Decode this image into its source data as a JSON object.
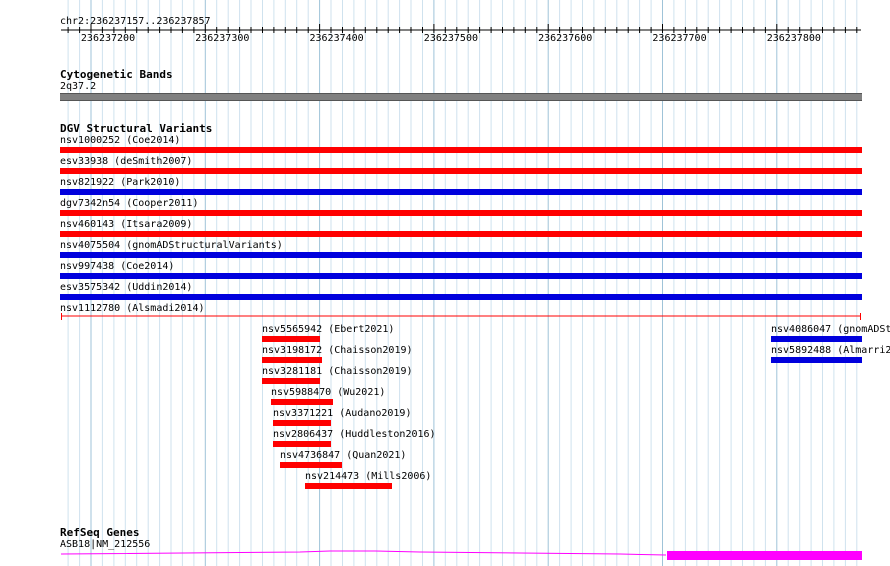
{
  "location": "chr2:236237157..236237857",
  "ruler": {
    "ticks": [
      "236237200",
      "236237300",
      "236237400",
      "236237500",
      "236237600",
      "236237700",
      "236237800"
    ]
  },
  "colors": {
    "gain_loss_red": "#ff0000",
    "gain_blue": "#0000dd",
    "band": "#808080",
    "refseq": "#ff00ff",
    "grid": "#b4d4e4"
  },
  "tracks": {
    "cytoband": {
      "title": "Cytogenetic Bands",
      "band_label": "2q37.2"
    },
    "dgv": {
      "title": "DGV Structural Variants",
      "full_width_features": [
        {
          "label": "nsv1000252 (Coe2014)",
          "color": "red"
        },
        {
          "label": "esv33938 (deSmith2007)",
          "color": "red"
        },
        {
          "label": "nsv821922 (Park2010)",
          "color": "blue"
        },
        {
          "label": "dgv7342n54 (Cooper2011)",
          "color": "red"
        },
        {
          "label": "nsv460143 (Itsara2009)",
          "color": "red"
        },
        {
          "label": "nsv4075504 (gnomADStructuralVariants)",
          "color": "blue"
        },
        {
          "label": "nsv997438 (Coe2014)",
          "color": "blue"
        },
        {
          "label": "esv3575342 (Uddin2014)",
          "color": "blue"
        },
        {
          "label": "nsv1112780 (Alsmadi2014)",
          "color": "line"
        }
      ],
      "short_features": [
        {
          "label": "nsv5565942 (Ebert2021)",
          "color": "red"
        },
        {
          "label": "nsv3198172 (Chaisson2019)",
          "color": "red"
        },
        {
          "label": "nsv3281181 (Chaisson2019)",
          "color": "red"
        },
        {
          "label": "nsv5988470 (Wu2021)",
          "color": "red"
        },
        {
          "label": "nsv3371221 (Audano2019)",
          "color": "red"
        },
        {
          "label": "nsv2806437 (Huddleston2016)",
          "color": "red"
        },
        {
          "label": "nsv4736847 (Quan2021)",
          "color": "red"
        },
        {
          "label": "nsv214473 (Mills2006)",
          "color": "red"
        },
        {
          "label": "nsv4086047 (gnomADSt",
          "color": "blue"
        },
        {
          "label": "nsv5892488 (Almarri2",
          "color": "blue"
        }
      ]
    },
    "refseq": {
      "title": "RefSeq Genes",
      "gene_label": "ASB18|NM_212556"
    }
  }
}
